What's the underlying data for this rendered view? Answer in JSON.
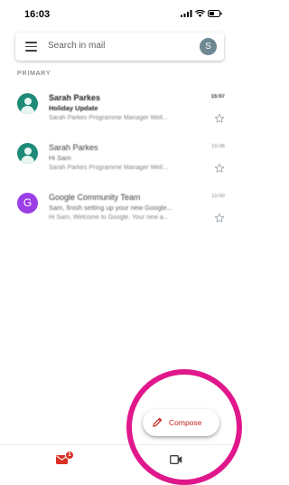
{
  "status_bar": {
    "time": "16:03",
    "icons": [
      "signal-icon",
      "wifi-icon",
      "battery-icon"
    ]
  },
  "search": {
    "placeholder": "Search in mail",
    "account_initial": "S",
    "account_color": "#6e8793"
  },
  "section": {
    "label": "PRIMARY"
  },
  "emails": [
    {
      "sender": "Sarah Parkes",
      "time": "15:07",
      "subject": "Holiday Update",
      "snippet": "Sarah Parkes Programme Manager Well...",
      "unread": true,
      "avatar": "person",
      "avatar_color": "#1e8a78",
      "starred": false
    },
    {
      "sender": "Sarah Parkes",
      "time": "15:06",
      "subject": "Hi Sam",
      "snippet": "Sarah Parkes Programme Manager Well...",
      "unread": false,
      "avatar": "person",
      "avatar_color": "#1e8a78",
      "starred": false
    },
    {
      "sender": "Google Community Team",
      "time": "15:00",
      "subject": "Sam, finish setting up your new Google...",
      "snippet": "Hi Sam, Welcome to Google. Your new a...",
      "unread": false,
      "avatar": "letter",
      "avatar_letter": "G",
      "avatar_color": "#9b3ee6",
      "starred": false
    }
  ],
  "compose": {
    "label": "Compose",
    "accent_color": "#c5221f"
  },
  "bottom_nav": {
    "mail_badge": "1",
    "tabs": [
      "mail-icon",
      "video-icon"
    ]
  },
  "annotation": {
    "ring_color": "#e0188c"
  }
}
